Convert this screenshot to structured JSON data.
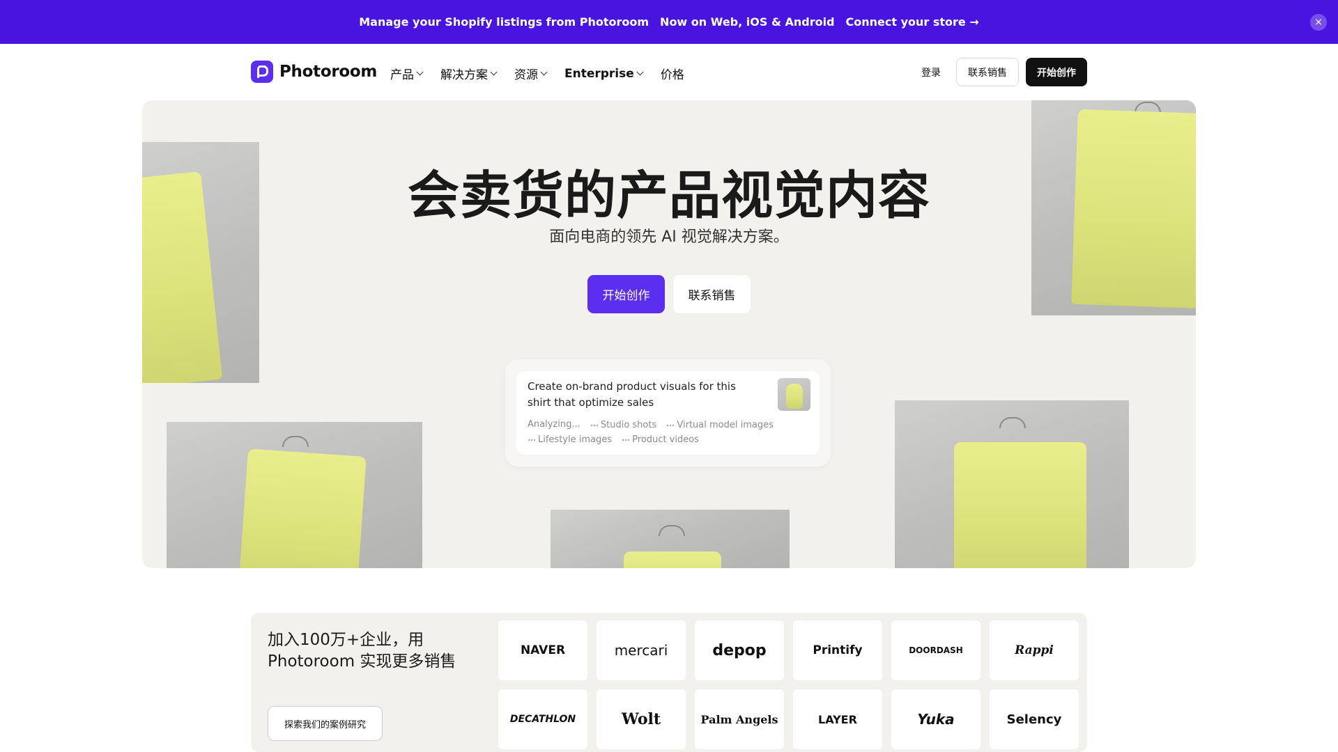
{
  "announcement": {
    "text_1": "Manage your Shopify listings from Photoroom",
    "text_2": "Now on Web, iOS & Android",
    "link": "Connect your store →",
    "close_icon": "×"
  },
  "nav": {
    "logo_text": "Photoroom",
    "menu": [
      {
        "label": "产品"
      },
      {
        "label": "解决方案"
      },
      {
        "label": "资源"
      },
      {
        "label": "Enterprise"
      },
      {
        "label": "价格"
      }
    ],
    "login": "登录",
    "contact_sales": "联系销售",
    "start_creating": "开始创作"
  },
  "hero": {
    "title": "会卖货的产品视觉内容",
    "subtitle": "面向电商的领先 AI 视觉解决方案。",
    "primary_button": "开始创作",
    "secondary_button": "联系销售",
    "prompt": {
      "text": "Create on-brand product visuals for this shirt that optimize sales",
      "tags": [
        "Analyzing...",
        "Studio shots",
        "Virtual model images",
        "Lifestyle images",
        "Product videos"
      ]
    }
  },
  "logos_section": {
    "heading": "加入100万+企业，用 Photoroom 实现更多销售",
    "cta": "探索我们的案例研究",
    "logos": [
      "NAVER",
      "mercari",
      "depop",
      "Printify",
      "DOORDASH",
      "Rappi",
      "DECATHLON",
      "Wolt",
      "Palm Angels",
      "LAYER",
      "Yuka",
      "Selency"
    ]
  },
  "colors": {
    "brand_purple": "#4a14e0",
    "button_purple": "#5b2ef0",
    "hero_bg": "#f3f1ee",
    "shirt_yellow": "#dbe27a"
  }
}
